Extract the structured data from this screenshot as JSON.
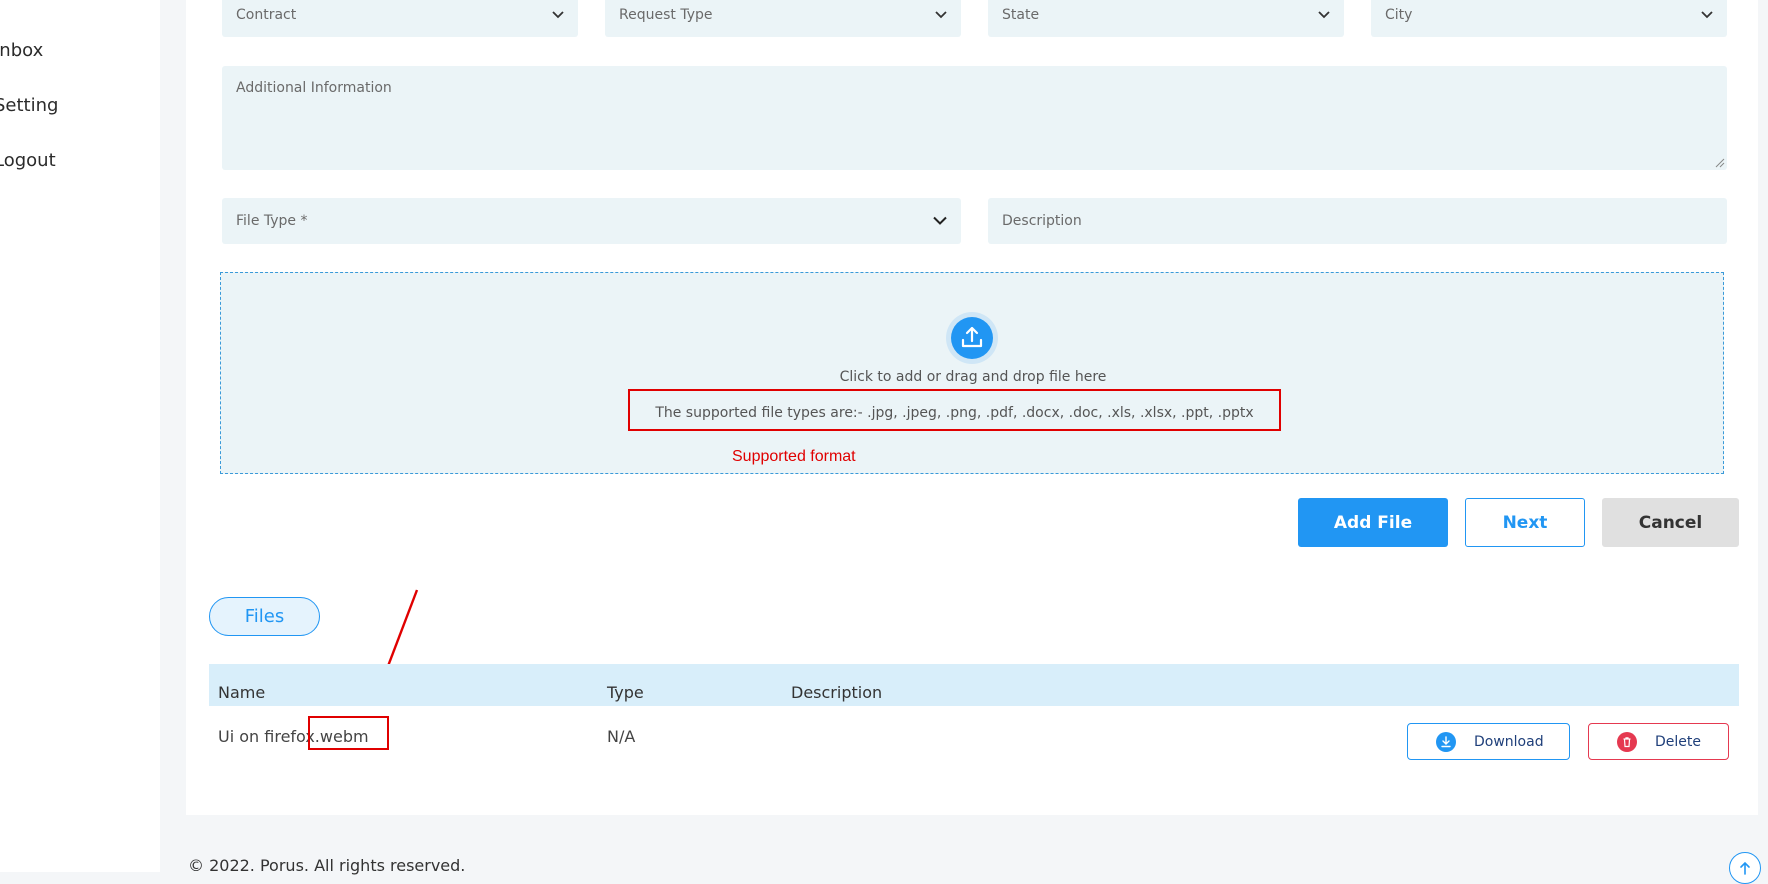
{
  "sidebar": {
    "items": [
      {
        "label": "Inbox"
      },
      {
        "label": "Setting"
      },
      {
        "label": "Logout"
      }
    ]
  },
  "form": {
    "top_row": [
      {
        "placeholder": "Contract"
      },
      {
        "placeholder": "Request Type"
      },
      {
        "placeholder": "State"
      },
      {
        "placeholder": "City"
      }
    ],
    "additional_info_placeholder": "Additional Information",
    "file_type_placeholder": "File Type *",
    "description_placeholder": "Description"
  },
  "dropzone": {
    "instruction": "Click to add or drag and drop file here",
    "supported_types": "The supported file types are:- .jpg, .jpeg, .png, .pdf, .docx, .doc, .xls, .xlsx, .ppt, .pptx"
  },
  "annotation": {
    "supported_format": "Supported format"
  },
  "buttons": {
    "add_file": "Add File",
    "next": "Next",
    "cancel": "Cancel"
  },
  "files": {
    "tab_label": "Files",
    "columns": [
      "Name",
      "Type",
      "Description"
    ],
    "rows": [
      {
        "name": "Ui on firefox.webm",
        "type": "N/A",
        "description": ""
      }
    ],
    "download_label": "Download",
    "delete_label": "Delete"
  },
  "footer": {
    "copyright": "© 2022. Porus. All rights reserved."
  },
  "colors": {
    "accent": "#2196f3",
    "field_bg": "#ebf4f7",
    "annotation_red": "#e00000",
    "cancel_bg": "#e0e0e0",
    "delete_red": "#e53950"
  }
}
